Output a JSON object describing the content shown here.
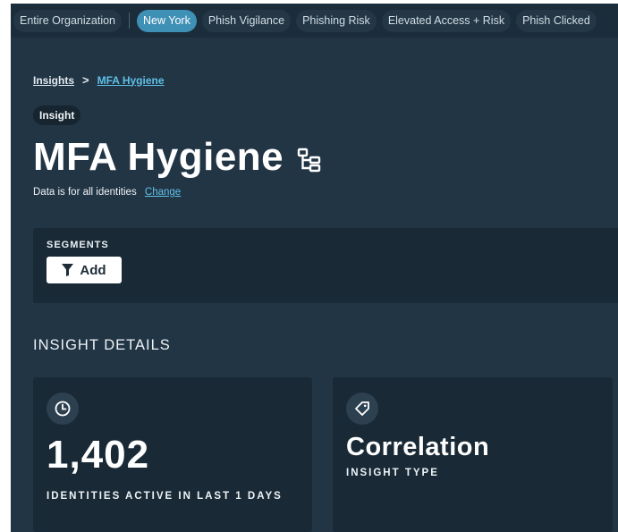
{
  "filters": {
    "items": [
      {
        "label": "Entire Organization",
        "active": false
      },
      {
        "label": "New York",
        "active": true
      },
      {
        "label": "Phish Vigilance",
        "active": false
      },
      {
        "label": "Phishing Risk",
        "active": false
      },
      {
        "label": "Elevated Access + Risk",
        "active": false
      },
      {
        "label": "Phish Clicked",
        "active": false
      }
    ]
  },
  "breadcrumb": {
    "root": "Insights",
    "separator": ">",
    "current": "MFA Hygiene"
  },
  "header": {
    "badge": "Insight",
    "title": "MFA Hygiene",
    "title_icon": "hierarchy-icon"
  },
  "scope": {
    "text": "Data is for all identities",
    "change_link": "Change"
  },
  "segments": {
    "label": "SEGMENTS",
    "add_button": "Add",
    "add_icon": "filter-icon"
  },
  "details": {
    "title": "INSIGHT DETAILS",
    "cards": [
      {
        "icon": "clock-icon",
        "value": "1,402",
        "label": "IDENTITIES ACTIVE IN LAST 1 DAYS"
      },
      {
        "icon": "tag-icon",
        "value": "Correlation",
        "label": "INSIGHT TYPE"
      }
    ]
  },
  "colors": {
    "background": "#223545",
    "panel": "#192a36",
    "accent": "#3f90b5",
    "link": "#5fc0e6"
  }
}
